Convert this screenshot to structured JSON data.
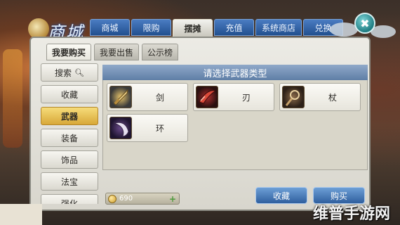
{
  "header": {
    "logo_text": "商城",
    "tabs": [
      {
        "label": "商城",
        "active": false
      },
      {
        "label": "限购",
        "active": false
      },
      {
        "label": "摆摊",
        "active": true
      },
      {
        "label": "充值",
        "active": false
      },
      {
        "label": "系统商店",
        "active": false
      },
      {
        "label": "兑换",
        "active": false
      }
    ],
    "close_icon": "close-icon"
  },
  "subtabs": [
    {
      "label": "我要购买",
      "active": true
    },
    {
      "label": "我要出售",
      "active": false
    },
    {
      "label": "公示榜",
      "active": false
    }
  ],
  "sidebar": {
    "search_label": "搜索",
    "search_icon": "search-icon",
    "items": [
      {
        "label": "收藏",
        "active": false
      },
      {
        "label": "武器",
        "active": true
      },
      {
        "label": "装备",
        "active": false
      },
      {
        "label": "饰品",
        "active": false
      },
      {
        "label": "法宝",
        "active": false
      },
      {
        "label": "强化",
        "active": false
      }
    ]
  },
  "content": {
    "header": "请选择武器类型",
    "items": [
      {
        "label": "剑",
        "icon": "sword-icon"
      },
      {
        "label": "刃",
        "icon": "blade-icon"
      },
      {
        "label": "杖",
        "icon": "staff-icon"
      },
      {
        "label": "环",
        "icon": "ring-icon"
      }
    ]
  },
  "footer": {
    "currency_value": "690",
    "currency_icon": "coin-icon",
    "add_icon": "plus-icon",
    "favorite_button": "收藏",
    "buy_button": "购买"
  },
  "watermark": "维普手游网"
}
